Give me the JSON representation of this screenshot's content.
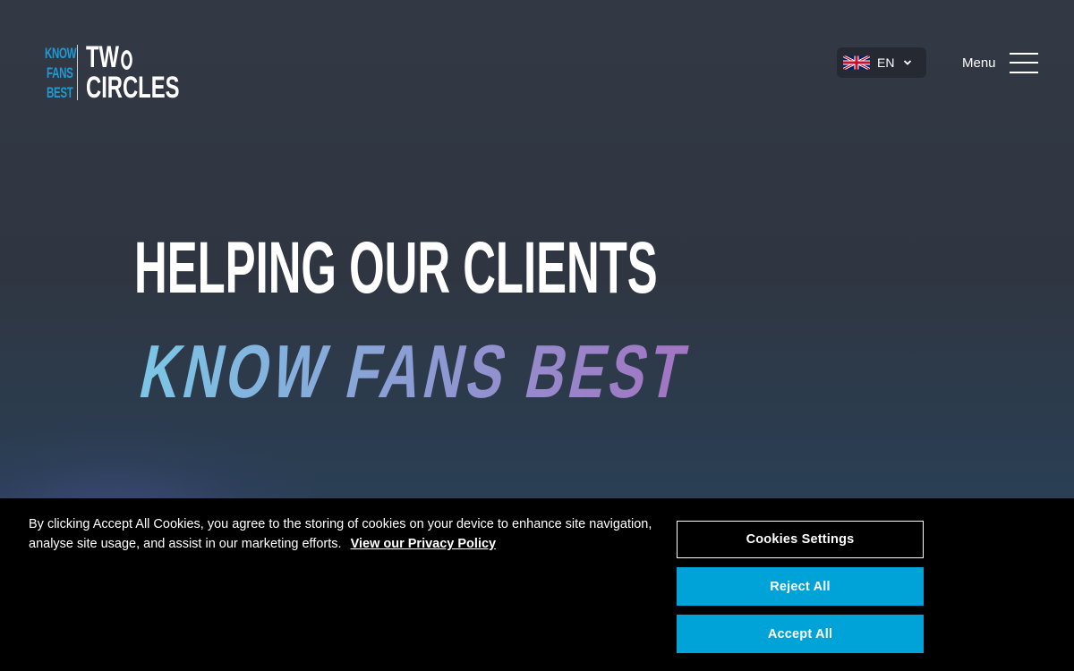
{
  "header": {
    "logo": {
      "left_lines": [
        "KNOW",
        "FANS",
        "BEST"
      ],
      "right_line1": "TW",
      "right_line2": "CIRCLES"
    },
    "language": {
      "code": "EN",
      "flag_icon": "uk-flag-icon"
    },
    "menu_label": "Menu"
  },
  "hero": {
    "title": "HELPING OUR CLIENTS",
    "slogan": "KNOW FANS BEST"
  },
  "cookie_banner": {
    "text": "By clicking Accept All Cookies, you agree to the storing of cookies on your device to enhance site navigation, analyse site usage, and assist in our marketing efforts.",
    "link": "View our Privacy Policy",
    "settings_label": "Cookies Settings",
    "reject_label": "Reject All",
    "accept_label": "Accept All"
  },
  "colors": {
    "accent_blue": "#00a3d8",
    "logo_blue": "#1e9ad6",
    "slogan_start": "#7cc6e6",
    "slogan_end": "#a374c2",
    "banner_bg": "#000000"
  }
}
